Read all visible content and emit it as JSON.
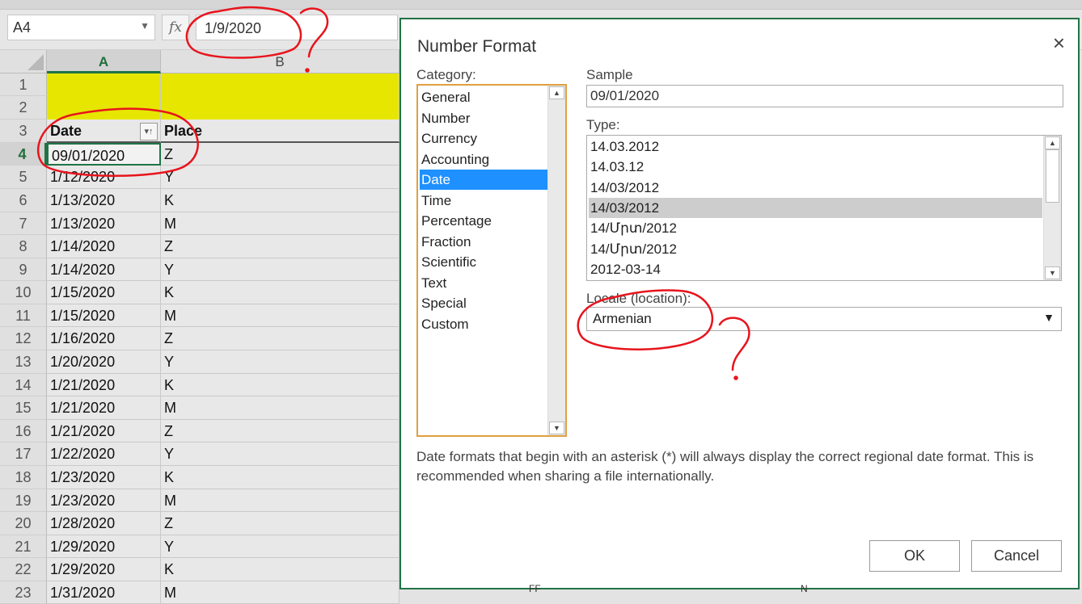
{
  "formula_bar": {
    "name_box": "A4",
    "fx_label": "fx",
    "formula_value": "1/9/2020"
  },
  "sheet": {
    "col_a": "A",
    "col_b": "B",
    "rows": [
      {
        "num": "1",
        "a": "",
        "b": "",
        "style": "yellow"
      },
      {
        "num": "2",
        "a": "",
        "b": "",
        "style": "yellow"
      },
      {
        "num": "3",
        "a": "Date",
        "b": "Place",
        "style": "header"
      },
      {
        "num": "4",
        "a": "09/01/2020",
        "b": "Z",
        "style": "active"
      },
      {
        "num": "5",
        "a": "1/12/2020",
        "b": "Y"
      },
      {
        "num": "6",
        "a": "1/13/2020",
        "b": "K"
      },
      {
        "num": "7",
        "a": "1/13/2020",
        "b": "M"
      },
      {
        "num": "8",
        "a": "1/14/2020",
        "b": "Z"
      },
      {
        "num": "9",
        "a": "1/14/2020",
        "b": "Y"
      },
      {
        "num": "10",
        "a": "1/15/2020",
        "b": "K"
      },
      {
        "num": "11",
        "a": "1/15/2020",
        "b": "M"
      },
      {
        "num": "12",
        "a": "1/16/2020",
        "b": "Z"
      },
      {
        "num": "13",
        "a": "1/20/2020",
        "b": "Y"
      },
      {
        "num": "14",
        "a": "1/21/2020",
        "b": "K"
      },
      {
        "num": "15",
        "a": "1/21/2020",
        "b": "M"
      },
      {
        "num": "16",
        "a": "1/21/2020",
        "b": "Z"
      },
      {
        "num": "17",
        "a": "1/22/2020",
        "b": "Y"
      },
      {
        "num": "18",
        "a": "1/23/2020",
        "b": "K"
      },
      {
        "num": "19",
        "a": "1/23/2020",
        "b": "M"
      },
      {
        "num": "20",
        "a": "1/28/2020",
        "b": "Z"
      },
      {
        "num": "21",
        "a": "1/29/2020",
        "b": "Y"
      },
      {
        "num": "22",
        "a": "1/29/2020",
        "b": "K"
      },
      {
        "num": "23",
        "a": "1/31/2020",
        "b": "M"
      }
    ]
  },
  "dialog": {
    "title": "Number Format",
    "close": "×",
    "category_label": "Category:",
    "categories": [
      "General",
      "Number",
      "Currency",
      "Accounting",
      "Date",
      "Time",
      "Percentage",
      "Fraction",
      "Scientific",
      "Text",
      "Special",
      "Custom"
    ],
    "selected_category": "Date",
    "sample_label": "Sample",
    "sample_value": "09/01/2020",
    "type_label": "Type:",
    "types": [
      "14.03.2012",
      "14.03.12",
      "14/03/2012",
      "14/03/2012",
      "14/Մրտ/2012",
      "14/Մրտ/2012",
      "2012-03-14"
    ],
    "selected_type_index": 3,
    "locale_label": "Locale (location):",
    "locale_value": "Armenian",
    "description": "Date formats that begin with an asterisk (*) will always display the correct regional date format. This is recommended when sharing a file internationally.",
    "ok": "OK",
    "cancel": "Cancel"
  },
  "background_fragments": {
    "left": "FF",
    "right": "N"
  },
  "colors": {
    "excel_green": "#217346",
    "selection_blue": "#1e90ff",
    "header_yellow": "#e6e600",
    "annotation_red": "#e8141c"
  }
}
